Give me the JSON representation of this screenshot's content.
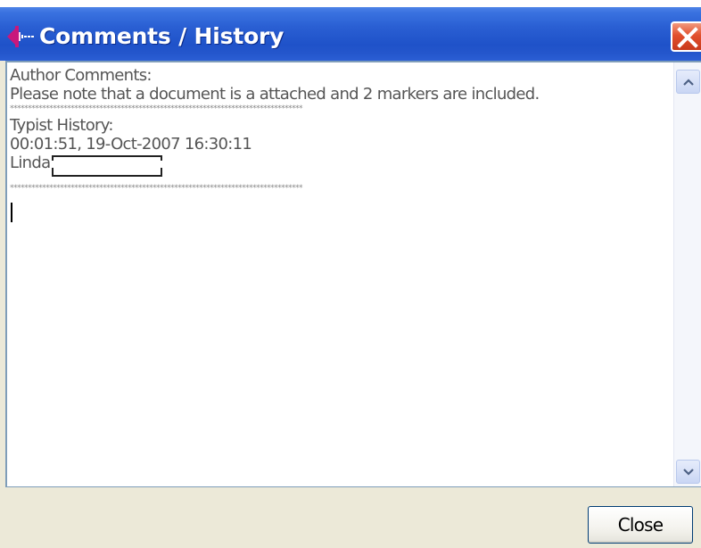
{
  "window": {
    "title": "Comments / History"
  },
  "comments": {
    "author_heading": "Author Comments:",
    "author_text": "Please note that a document is a attached and 2 markers are included.",
    "separator_1": "**********************************************************************************",
    "typist_heading": "Typist History:",
    "typist_entry": "00:01:51, 19-Oct-2007 16:30:11",
    "typist_name": "Linda",
    "separator_2": "**********************************************************************************"
  },
  "footer": {
    "close_label": "Close"
  },
  "icons": {
    "app": "audio-waveform-icon",
    "close": "close-icon",
    "scroll_up": "chevron-up-icon",
    "scroll_down": "chevron-down-icon"
  },
  "colors": {
    "titlebar": "#2456cc",
    "close_x": "#e2502d",
    "app_icon": "#c8187c",
    "text": "#555555",
    "dialog_bg": "#ece9d8"
  }
}
